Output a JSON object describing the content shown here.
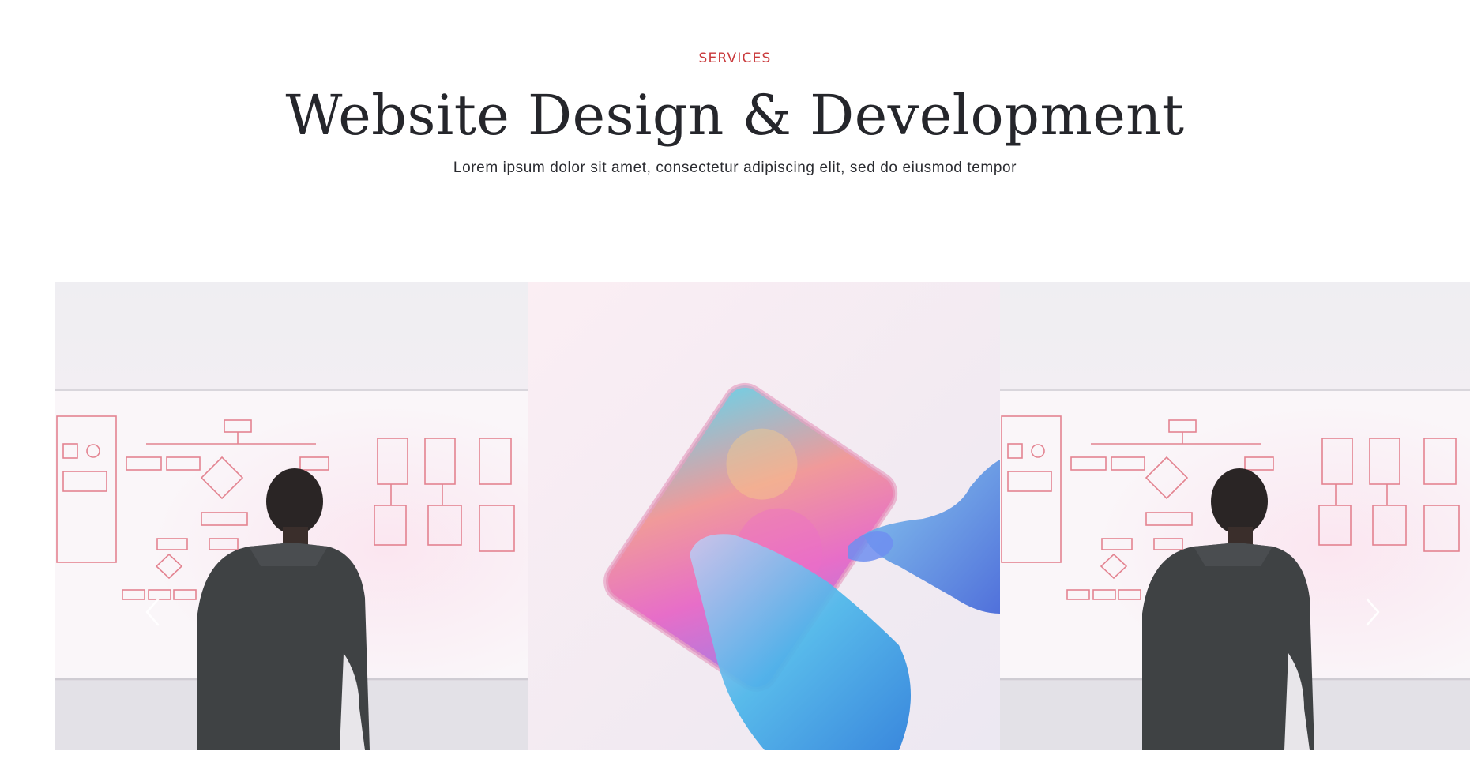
{
  "section": {
    "eyebrow": "SERVICES",
    "title": "Website Design & Development",
    "subtitle": "Lorem ipsum dolor sit amet, consectetur adipiscing elit, sed do eiusmod tempor"
  },
  "carousel": {
    "slides": [
      {
        "name": "whiteboard-planning-image",
        "icon": "person-whiteboard"
      },
      {
        "name": "smartphone-touch-image",
        "icon": "hand-phone"
      },
      {
        "name": "whiteboard-planning-image",
        "icon": "person-whiteboard"
      }
    ],
    "prev_icon": "chevron-left-icon",
    "next_icon": "chevron-right-icon"
  },
  "colors": {
    "accent": "#c9393b",
    "heading": "#25262b",
    "text": "#2a2b30"
  }
}
